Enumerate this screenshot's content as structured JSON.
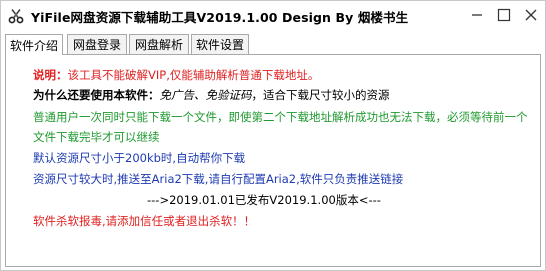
{
  "window": {
    "title": "YiFile网盘资源下载辅助工具V2019.1.00  Design By 烟楼书生",
    "icons": {
      "app": "scissors-icon",
      "minimize": "minimize-icon",
      "maximize": "maximize-icon",
      "close": "close-icon"
    }
  },
  "tabs": [
    {
      "label": "软件介绍",
      "active": true
    },
    {
      "label": "网盘登录",
      "active": false
    },
    {
      "label": "网盘解析",
      "active": false
    },
    {
      "label": "软件设置",
      "active": false
    }
  ],
  "content": {
    "line1_label": "说明：",
    "line1_text": "该工具不能破解VIP,仅能辅助解析普通下载地址。",
    "line2_label": "为什么还要使用本软件：",
    "line2_italic": "免广告、免验证码",
    "line2_text": "，适合下载尺寸较小的资源",
    "line3": "普通用户一次同时只能下载一个文件，即使第二个下载地址解析成功也无法下载，必须等待前一个",
    "line4": "文件下载完毕才可以继续",
    "line5": "默认资源尺寸小于200kb时,自动帮你下载",
    "line6": "资源尺寸较大时,推送至Aria2下载,请自行配置Aria2,软件只负责推送链接",
    "line7": "--->2019.01.01已发布V2019.1.00版本<---",
    "line8": "软件杀软报毒,请添加信任或者退出杀软！！"
  },
  "colors": {
    "red": "#e02020",
    "green": "#1f9a2f",
    "blue": "#1f3bb0"
  }
}
